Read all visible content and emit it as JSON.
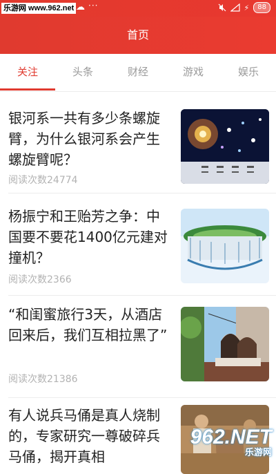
{
  "statusbar": {
    "watermark": "乐游网 www.962.net",
    "dots": "···",
    "battery": "88"
  },
  "header": {
    "title": "首页"
  },
  "tabs": [
    {
      "label": "关注",
      "active": true
    },
    {
      "label": "头条"
    },
    {
      "label": "财经"
    },
    {
      "label": "游戏"
    },
    {
      "label": "娱乐"
    }
  ],
  "articles": [
    {
      "title": "银河系一共有多少条螺旋臂，为什么银河系会产生螺旋臂呢？",
      "meta": "阅读次数24774",
      "thumb": "galaxy-image"
    },
    {
      "title": "杨振宁和王贻芳之争：中国要不要花1400亿元建对撞机？",
      "meta": "阅读次数2366",
      "thumb": "collider-image"
    },
    {
      "title": "“和闺蜜旅行3天，从酒店回来后，我们互相拉黑了”",
      "meta": "阅读次数21386",
      "thumb": "friends-image"
    },
    {
      "title": "有人说兵马俑是真人烧制的，专家研究一尊破碎兵马俑，揭开真相",
      "meta": "",
      "thumb": "terracotta-image"
    }
  ],
  "bottom_watermark": {
    "big": "962.NET",
    "small": "乐游网"
  },
  "colors": {
    "accent": "#e03a2f",
    "muted": "#9a9a9a",
    "meta": "#b2b2b2"
  }
}
